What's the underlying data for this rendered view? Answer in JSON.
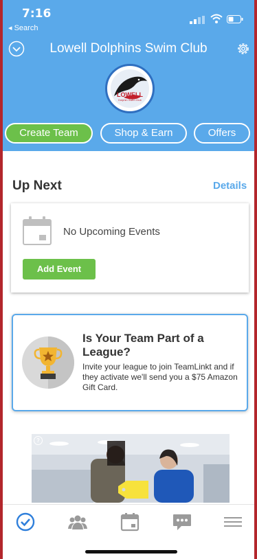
{
  "status": {
    "time": "7:16",
    "back_label": "◂ Search"
  },
  "header": {
    "title": "Lowell Dolphins Swim Club",
    "logo_text": "LOWELL",
    "logo_subtext": "Dolphin Swim Club"
  },
  "actions": {
    "create_team": "Create Team",
    "shop_earn": "Shop & Earn",
    "offers": "Offers"
  },
  "up_next": {
    "heading": "Up Next",
    "details_link": "Details",
    "empty_text": "No Upcoming Events",
    "add_event": "Add Event"
  },
  "league": {
    "title": "Is Your Team Part of a League?",
    "body": "Invite your league to join TeamLinkt and if they activate we'll send you a $75 Amazon Gift Card."
  },
  "ad": {
    "info_glyph": "?"
  },
  "tabs": [
    "home-check-icon",
    "team-icon",
    "calendar-icon",
    "chat-icon",
    "menu-icon"
  ],
  "colors": {
    "brand_blue": "#5aa9ea",
    "green": "#6cc04a",
    "frame_red": "#b3262c"
  }
}
